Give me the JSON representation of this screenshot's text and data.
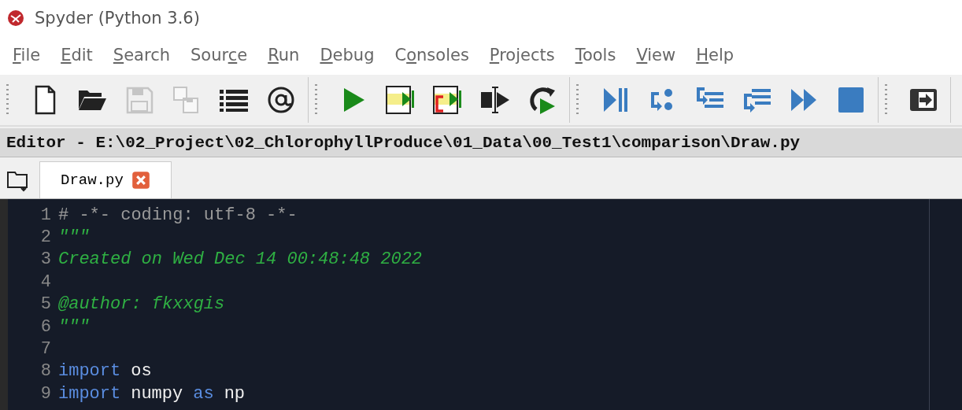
{
  "window": {
    "title": "Spyder (Python 3.6)"
  },
  "menu": [
    {
      "key": "F",
      "post": "ile"
    },
    {
      "key": "E",
      "post": "dit"
    },
    {
      "key": "S",
      "post": "earch"
    },
    {
      "pre": "Sour",
      "key": "c",
      "post": "e"
    },
    {
      "key": "R",
      "post": "un"
    },
    {
      "key": "D",
      "post": "ebug"
    },
    {
      "pre": "C",
      "key": "o",
      "post": "nsoles"
    },
    {
      "key": "P",
      "post": "rojects"
    },
    {
      "key": "T",
      "post": "ools"
    },
    {
      "key": "V",
      "post": "iew"
    },
    {
      "key": "H",
      "post": "elp"
    }
  ],
  "toolbar": [
    [
      {
        "kind": "new",
        "disabled": false
      },
      {
        "kind": "open",
        "disabled": false
      },
      {
        "kind": "save",
        "disabled": true
      },
      {
        "kind": "saveall",
        "disabled": true
      },
      {
        "kind": "list",
        "disabled": false
      },
      {
        "kind": "at",
        "disabled": false
      }
    ],
    [
      {
        "kind": "run",
        "disabled": false
      },
      {
        "kind": "cell",
        "disabled": false
      },
      {
        "kind": "celladv",
        "disabled": false
      },
      {
        "kind": "selection",
        "disabled": false
      },
      {
        "kind": "rerun",
        "disabled": false
      }
    ],
    [
      {
        "kind": "debug",
        "disabled": false
      },
      {
        "kind": "step",
        "disabled": false
      },
      {
        "kind": "stepin",
        "disabled": false
      },
      {
        "kind": "stepout",
        "disabled": false
      },
      {
        "kind": "continue",
        "disabled": false
      },
      {
        "kind": "stop",
        "disabled": false
      }
    ],
    [
      {
        "kind": "maximize",
        "disabled": false
      }
    ]
  ],
  "editor": {
    "path": "Editor - E:\\02_Project\\02_ChlorophyllProduce\\01_Data\\00_Test1\\comparison\\Draw.py",
    "tabs": [
      {
        "label": "Draw.py",
        "selected": true
      }
    ],
    "lines": [
      {
        "number": "1",
        "tokens": [
          {
            "kind": "comment",
            "text": "# -*- coding: utf-8 -*-"
          }
        ]
      },
      {
        "number": "2",
        "tokens": [
          {
            "kind": "string",
            "text": "\"\"\""
          }
        ]
      },
      {
        "number": "3",
        "tokens": [
          {
            "kind": "string",
            "text": "Created on Wed Dec 14 00:48:48 2022"
          }
        ]
      },
      {
        "number": "4"
      },
      {
        "number": "5",
        "tokens": [
          {
            "kind": "string",
            "text": "@author: fkxxgis"
          }
        ]
      },
      {
        "number": "6",
        "tokens": [
          {
            "kind": "string",
            "text": "\"\"\""
          }
        ]
      },
      {
        "number": "7"
      },
      {
        "number": "8",
        "tokens": [
          {
            "kind": "keyword",
            "text": "import"
          },
          {
            "kind": "plain",
            "text": "os"
          }
        ]
      },
      {
        "number": "9",
        "tokens": [
          {
            "kind": "keyword",
            "text": "import"
          },
          {
            "kind": "plain",
            "text": "numpy"
          },
          {
            "kind": "keyword",
            "text": "as"
          },
          {
            "kind": "plain",
            "text": "np"
          }
        ]
      }
    ]
  }
}
